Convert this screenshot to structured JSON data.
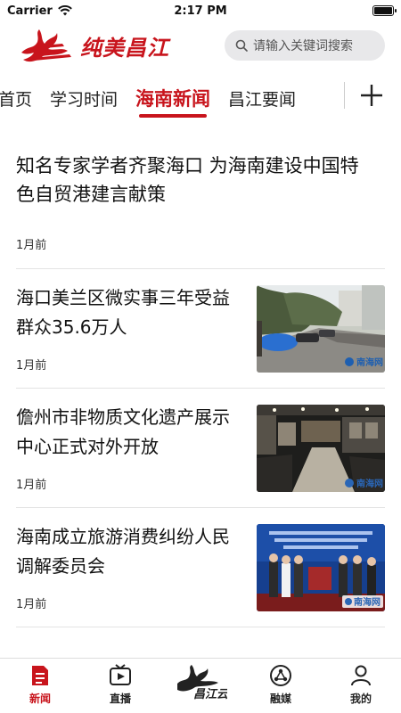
{
  "status_bar": {
    "carrier": "Carrier",
    "time": "2:17 PM"
  },
  "header": {
    "logo_text": "纯美昌江",
    "search_placeholder": "请输入关键词搜索"
  },
  "tabs": [
    {
      "label": "首页"
    },
    {
      "label": "学习时间"
    },
    {
      "label": "海南新闻",
      "active": true
    },
    {
      "label": "昌江要闻"
    }
  ],
  "articles": [
    {
      "title": "知名专家学者齐聚海口 为海南建设中国特色自贸港建言献策",
      "time": "1月前",
      "thumb": null
    },
    {
      "title": "海口美兰区微实事三年受益群众35.6万人",
      "time": "1月前",
      "thumb": "street",
      "watermark": "南海网"
    },
    {
      "title": "儋州市非物质文化遗产展示中心正式对外开放",
      "time": "1月前",
      "thumb": "hall",
      "watermark": "南海网"
    },
    {
      "title": "海南成立旅游消费纠纷人民调解委员会",
      "time": "1月前",
      "thumb": "ceremony",
      "watermark": "南海网"
    }
  ],
  "tabbar": {
    "items": [
      {
        "label": "新闻",
        "icon": "news-icon",
        "active": true
      },
      {
        "label": "直播",
        "icon": "tv-icon"
      },
      {
        "label": "昌江云",
        "icon": "changjiang-cloud-logo"
      },
      {
        "label": "融媒",
        "icon": "media-icon"
      },
      {
        "label": "我的",
        "icon": "profile-icon"
      }
    ]
  },
  "colors": {
    "accent": "#c8141c",
    "search_bg": "#e8e8ea",
    "divider": "#e3e3e3"
  }
}
